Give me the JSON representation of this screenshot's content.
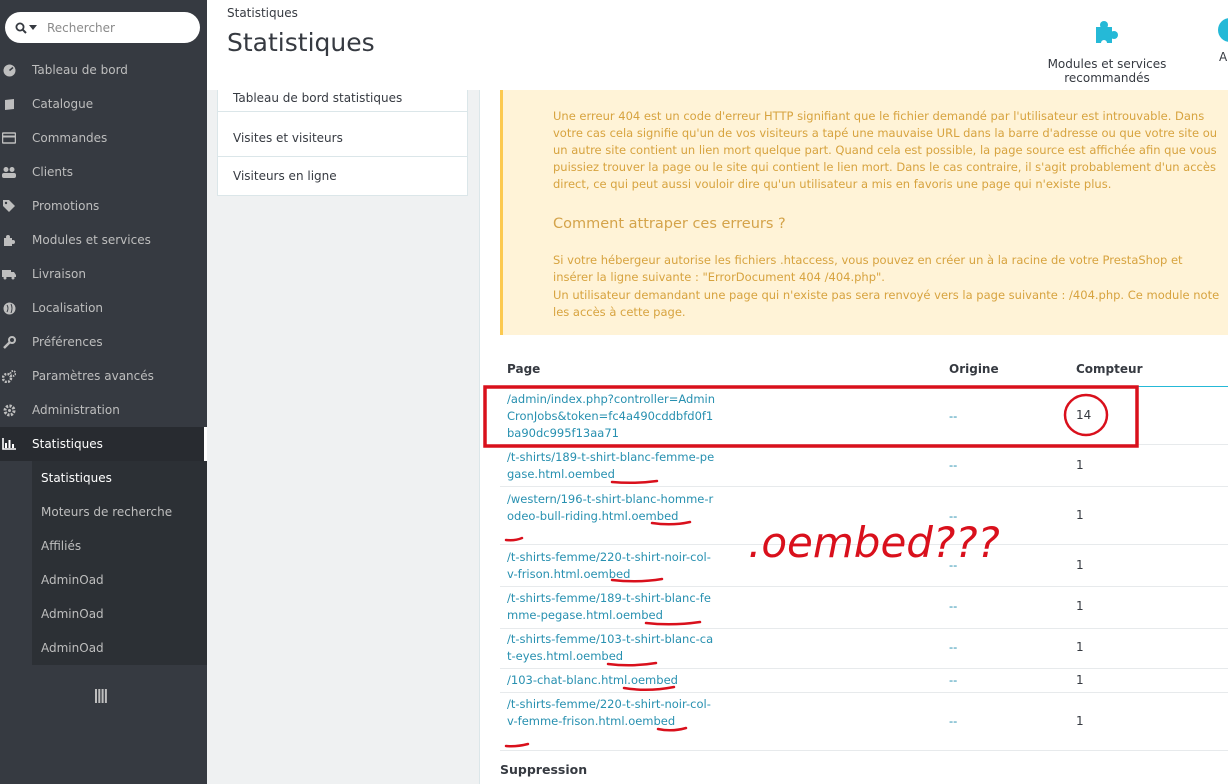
{
  "search": {
    "placeholder": "Rechercher"
  },
  "sidebar": {
    "items": [
      {
        "label": "Tableau de bord",
        "icon": "dashboard-icon"
      },
      {
        "label": "Catalogue",
        "icon": "book-icon"
      },
      {
        "label": "Commandes",
        "icon": "credit-card-icon"
      },
      {
        "label": "Clients",
        "icon": "users-icon"
      },
      {
        "label": "Promotions",
        "icon": "tag-icon"
      },
      {
        "label": "Modules et services",
        "icon": "puzzle-icon"
      },
      {
        "label": "Livraison",
        "icon": "truck-icon"
      },
      {
        "label": "Localisation",
        "icon": "globe-icon"
      },
      {
        "label": "Préférences",
        "icon": "wrench-icon"
      },
      {
        "label": "Paramètres avancés",
        "icon": "cogs-icon"
      },
      {
        "label": "Administration",
        "icon": "gear-icon"
      },
      {
        "label": "Statistiques",
        "icon": "bar-chart-icon"
      }
    ],
    "subitems": [
      {
        "label": "Statistiques"
      },
      {
        "label": "Moteurs de recherche"
      },
      {
        "label": "Affiliés"
      },
      {
        "label": "AdminOad"
      },
      {
        "label": "AdminOad"
      },
      {
        "label": "AdminOad"
      }
    ]
  },
  "header": {
    "breadcrumb": "Statistiques",
    "title": "Statistiques",
    "modules_label": "Modules et services recommandés",
    "help_label": "A"
  },
  "subnav": {
    "items": [
      {
        "label": "Tableau de bord statistiques"
      },
      {
        "label": "Visites et visiteurs"
      },
      {
        "label": "Visiteurs en ligne"
      }
    ]
  },
  "alert": {
    "paragraph1": "Une erreur 404 est un code d'erreur HTTP signifiant que le fichier demandé par l'utilisateur est introuvable. Dans votre cas cela signifie qu'un de vos visiteurs a tapé une mauvaise URL dans la barre d'adresse ou que votre site ou un autre site contient un lien mort quelque part. Quand cela est possible, la page source est affichée afin que vous puissiez trouver la page ou le site qui contient le lien mort. Dans le cas contraire, il s'agit probablement d'un accès direct, ce qui peut aussi vouloir dire qu'un utilisateur a mis en favoris une page qui n'existe plus.",
    "heading": "Comment attraper ces erreurs ?",
    "paragraph2": "Si votre hébergeur autorise les fichiers .htaccess, vous pouvez en créer un à la racine de votre PrestaShop et insérer la ligne suivante : \"ErrorDocument 404 /404.php\".",
    "paragraph3": "Un utilisateur demandant une page qui n'existe pas sera renvoyé vers la page suivante : /404.php. Ce module note les accès à cette page."
  },
  "table": {
    "headers": {
      "page": "Page",
      "origin": "Origine",
      "count": "Compteur"
    },
    "rows": [
      {
        "page": "/admin/index.php?controller=AdminCronJobs&token=fc4a490cddbfd0f1ba90dc995f13aa71",
        "origin": "--",
        "count": "14"
      },
      {
        "page": "/t-shirts/189-t-shirt-blanc-femme-pegase.html.oembed",
        "origin": "--",
        "count": "1"
      },
      {
        "page": "/western/196-t-shirt-blanc-homme-rodeo-bull-riding.html.oembed",
        "origin": "--",
        "count": "1"
      },
      {
        "page": "/t-shirts-femme/220-t-shirt-noir-col-v-frison.html.oembed",
        "origin": "--",
        "count": "1"
      },
      {
        "page": "/t-shirts-femme/189-t-shirt-blanc-femme-pegase.html.oembed",
        "origin": "--",
        "count": "1"
      },
      {
        "page": "/t-shirts-femme/103-t-shirt-blanc-cat-eyes.html.oembed",
        "origin": "--",
        "count": "1"
      },
      {
        "page": "/103-chat-blanc.html.oembed",
        "origin": "--",
        "count": "1"
      },
      {
        "page": "/t-shirts-femme/220-t-shirt-noir-col-v-femme-frison.html.oembed",
        "origin": "--",
        "count": "1"
      }
    ]
  },
  "footer": {
    "suppression_label": "Suppression"
  },
  "annotation": {
    "text": ".oembed???",
    "color": "#d9101c"
  }
}
